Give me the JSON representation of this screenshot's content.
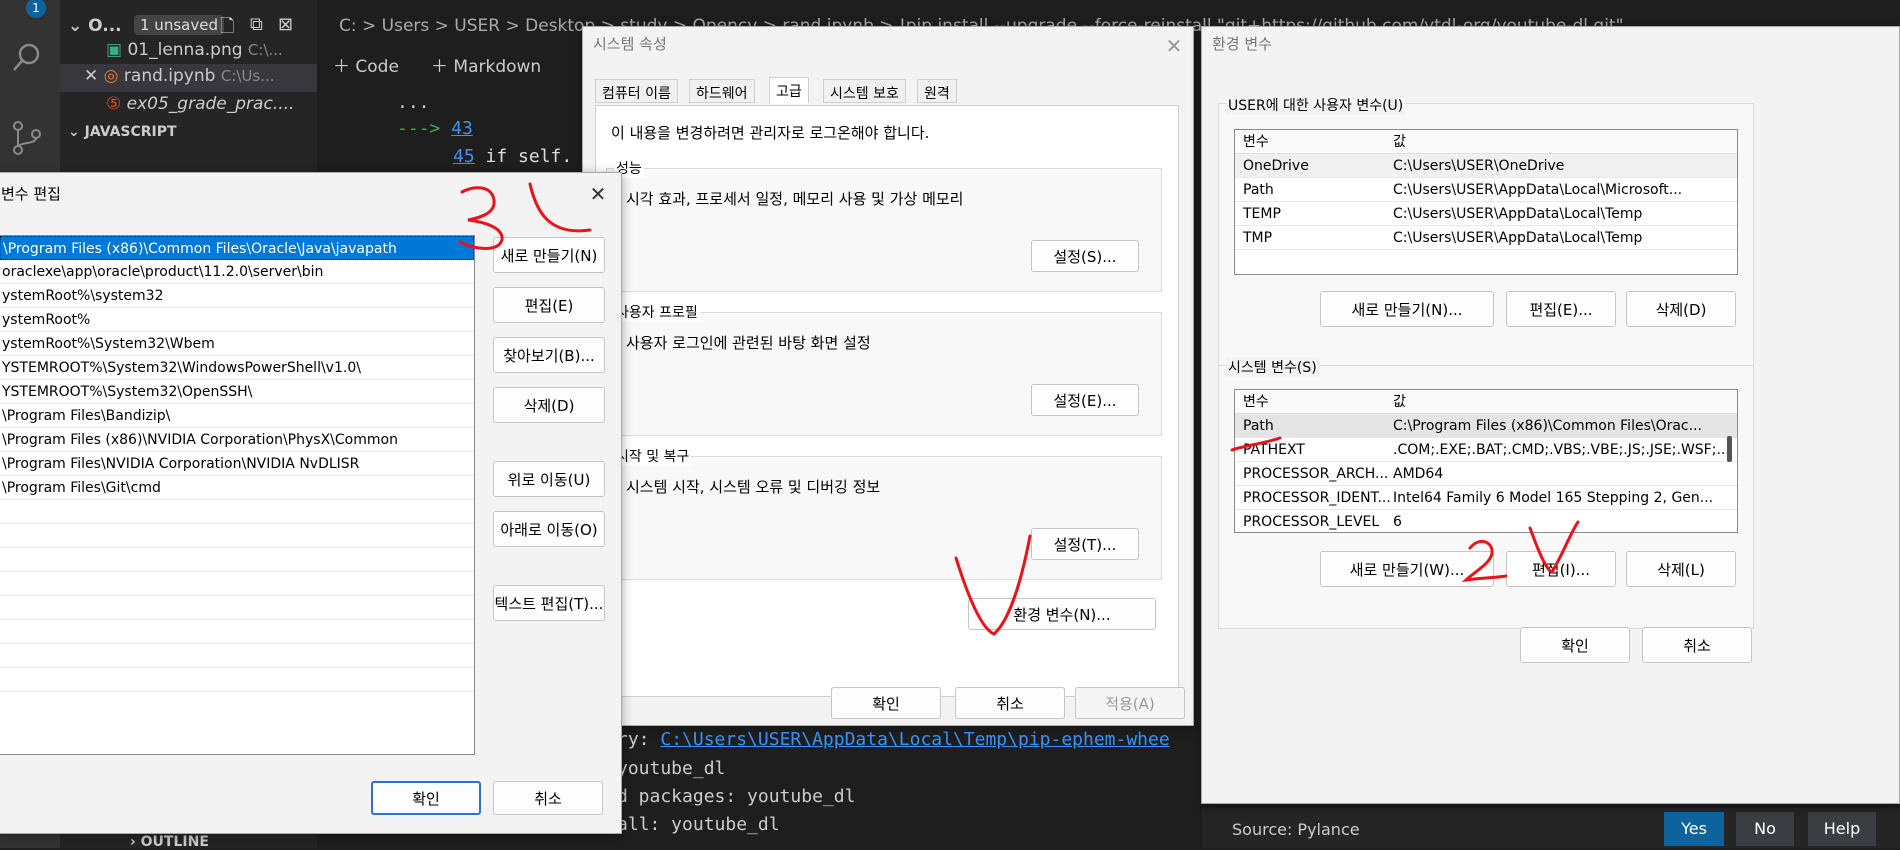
{
  "vscode": {
    "activity_badge": "1",
    "explorer": {
      "open_editors_label": "O...",
      "unsaved_badge": "1 unsaved",
      "files": [
        {
          "name": "01_lenna.png",
          "path": "C:\\..."
        },
        {
          "name": "rand.ipynb",
          "path": "C:\\Us..."
        },
        {
          "name": "ex05_grade_prac....",
          "path": ""
        }
      ],
      "javascript_header": "JAVASCRIPT",
      "outline_header": "OUTLINE"
    },
    "breadcrumb": "C: > Users > USER > Desktop > study > Opencv > rand.ipynb > !pip install --upgrade --force-reinstall \"git+https://github.com/ytdl-org/youtube-dl.git\"",
    "toolbar": {
      "code": "Code",
      "markdown": "Markdown"
    },
    "code_lines": [
      {
        "text": "...",
        "color": "#cccccc"
      },
      {
        "arrow": "--->",
        "num": "43",
        "text": ""
      },
      {
        "arrow": "",
        "num": "45",
        "text": "if self."
      }
    ],
    "terminal_lines": [
      {
        "prefix": "ry: ",
        "link": "C:\\Users\\USER\\AppData\\Local\\Temp\\pip-ephem-whee"
      },
      {
        "prefix": "youtube_dl",
        "link": ""
      },
      {
        "prefix": "d packages: youtube_dl",
        "link": ""
      },
      {
        "prefix": "all: youtube_dl",
        "link": ""
      }
    ],
    "notification": {
      "source": "Source: Pylance",
      "yes": "Yes",
      "no": "No",
      "help": "Help"
    },
    "accent": "#0e639c"
  },
  "edit_env_dialog": {
    "title": "변수 편집",
    "entries": [
      "\\Program Files (x86)\\Common Files\\Oracle\\Java\\javapath",
      "oraclexe\\app\\oracle\\product\\11.2.0\\server\\bin",
      "ystemRoot%\\system32",
      "ystemRoot%",
      "ystemRoot%\\System32\\Wbem",
      "YSTEMROOT%\\System32\\WindowsPowerShell\\v1.0\\",
      "YSTEMROOT%\\System32\\OpenSSH\\",
      "\\Program Files\\Bandizip\\",
      "\\Program Files (x86)\\NVIDIA Corporation\\PhysX\\Common",
      "\\Program Files\\NVIDIA Corporation\\NVIDIA NvDLISR",
      "\\Program Files\\Git\\cmd"
    ],
    "buttons": {
      "new": "새로 만들기(N)",
      "edit": "편집(E)",
      "browse": "찾아보기(B)...",
      "delete": "삭제(D)",
      "move_up": "위로 이동(U)",
      "move_down": "아래로 이동(O)",
      "edit_text": "텍스트 편집(T)...",
      "ok": "확인",
      "cancel": "취소"
    }
  },
  "sys_props_dialog": {
    "title": "시스템 속성",
    "tabs": [
      "컴퓨터 이름",
      "하드웨어",
      "고급",
      "시스템 보호",
      "원격"
    ],
    "admin_note": "이 내용을 변경하려면 관리자로 로그온해야 합니다.",
    "performance": {
      "label": "성능",
      "desc": "시각 효과, 프로세서 일정, 메모리 사용 및 가상 메모리",
      "button": "설정(S)..."
    },
    "profile": {
      "label": "사용자 프로필",
      "desc": "사용자 로그인에 관련된 바탕 화면 설정",
      "button": "설정(E)..."
    },
    "startup": {
      "label": "시작 및 복구",
      "desc": "시스템 시작, 시스템 오류 및 디버깅 정보",
      "button": "설정(T)..."
    },
    "env_button": "환경 변수(N)...",
    "ok": "확인",
    "cancel": "취소",
    "apply": "적용(A)"
  },
  "env_vars_dialog": {
    "title": "환경 변수",
    "user_group_label": "USER에 대한 사용자 변수(U)",
    "col_var": "변수",
    "col_val": "값",
    "user_vars": [
      {
        "name": "OneDrive",
        "value": "C:\\Users\\USER\\OneDrive"
      },
      {
        "name": "Path",
        "value": "C:\\Users\\USER\\AppData\\Local\\Microsoft..."
      },
      {
        "name": "TEMP",
        "value": "C:\\Users\\USER\\AppData\\Local\\Temp"
      },
      {
        "name": "TMP",
        "value": "C:\\Users\\USER\\AppData\\Local\\Temp"
      }
    ],
    "user_buttons": {
      "new": "새로 만들기(N)...",
      "edit": "편집(E)...",
      "delete": "삭제(D)"
    },
    "system_group_label": "시스템 변수(S)",
    "system_vars": [
      {
        "name": "Path",
        "value": "C:\\Program Files (x86)\\Common Files\\Orac..."
      },
      {
        "name": "PATHEXT",
        "value": ".COM;.EXE;.BAT;.CMD;.VBS;.VBE;.JS;.JSE;.WSF;..."
      },
      {
        "name": "PROCESSOR_ARCH...",
        "value": "AMD64"
      },
      {
        "name": "PROCESSOR_IDENT...",
        "value": "Intel64 Family 6 Model 165 Stepping 2, Gen..."
      },
      {
        "name": "PROCESSOR_LEVEL",
        "value": "6"
      }
    ],
    "system_buttons": {
      "new": "새로 만들기(W)...",
      "edit": "편집(I)...",
      "delete": "삭제(L)"
    },
    "ok": "확인",
    "cancel": "취소"
  },
  "annotations": {
    "three": "3",
    "two": "2",
    "color": "#e8141b"
  },
  "colors": {
    "selection": "#0078d7",
    "link": "#3794ff",
    "num": "#569cd6"
  }
}
